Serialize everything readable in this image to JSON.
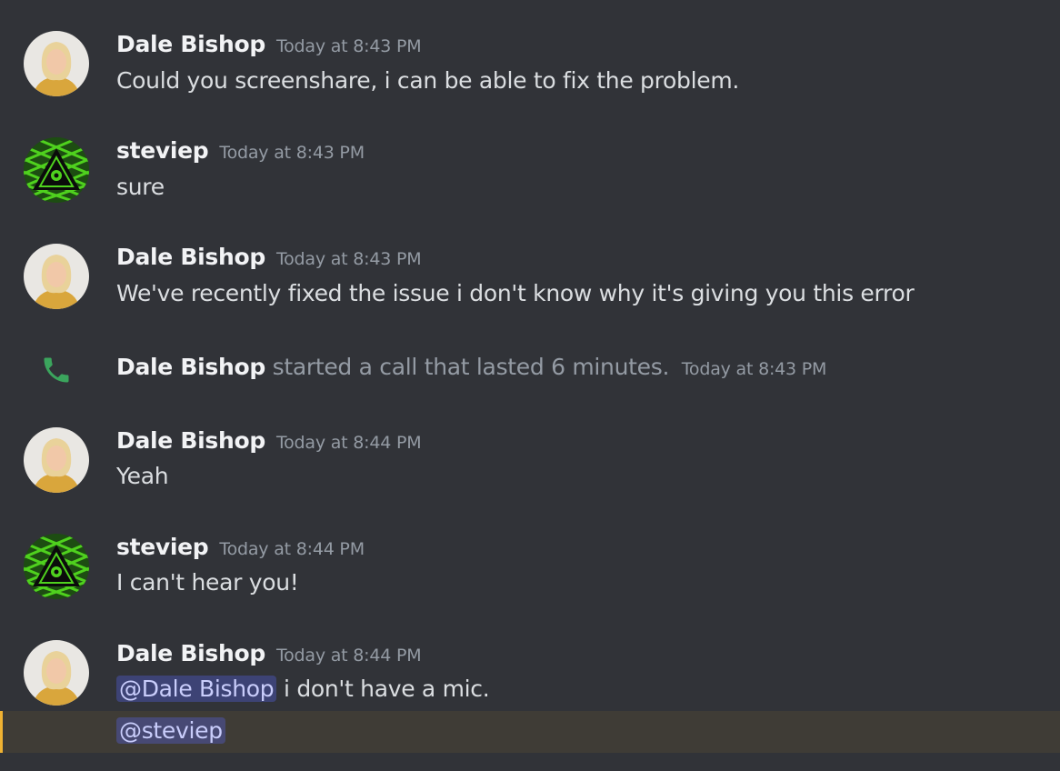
{
  "messages": [
    {
      "author": "Dale Bishop",
      "timestamp": "Today at 8:43 PM",
      "text": "Could you screenshare, i can be able to fix the problem."
    },
    {
      "author": "steviep",
      "timestamp": "Today at 8:43 PM",
      "text": "sure"
    },
    {
      "author": "Dale Bishop",
      "timestamp": "Today at 8:43 PM",
      "text": "We've recently fixed the issue i don't know why it's giving you this error"
    },
    {
      "author": "Dale Bishop",
      "timestamp": "Today at 8:44 PM",
      "text": "Yeah"
    },
    {
      "author": "steviep",
      "timestamp": "Today at 8:44 PM",
      "text": "I can't hear you!"
    },
    {
      "author": "Dale Bishop",
      "timestamp": "Today at 8:44 PM",
      "mention": "@Dale Bishop",
      "text": " i don't have a mic.",
      "mention2": "@steviep"
    }
  ],
  "call_event": {
    "author": "Dale Bishop",
    "description": "started a call that lasted 6 minutes.",
    "timestamp": "Today at 8:43 PM",
    "icon": "phone-icon"
  },
  "colors": {
    "background": "#313338",
    "highlight": "#3f3c36",
    "mention_bg": "#4e5188",
    "call_icon": "#3ba55d"
  }
}
